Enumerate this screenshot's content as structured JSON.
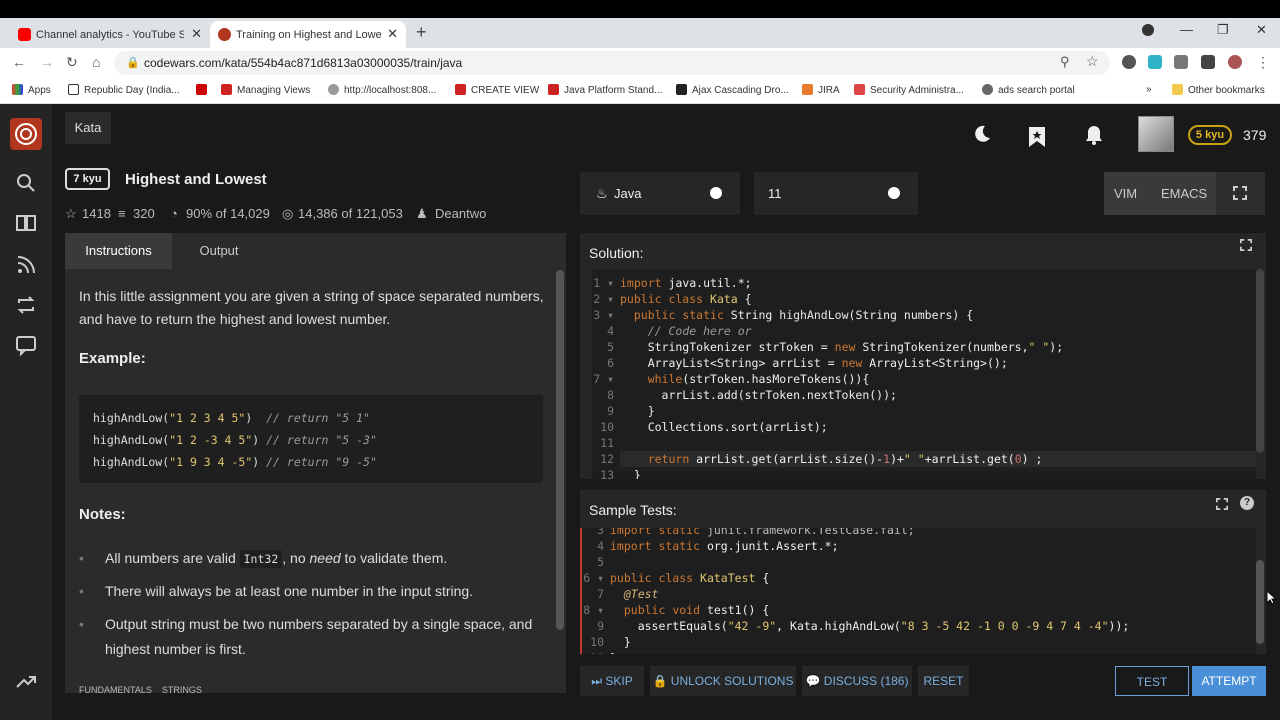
{
  "browser": {
    "tabs": [
      {
        "label": "Channel analytics - YouTube Stu",
        "active": false
      },
      {
        "label": "Training on Highest and Lowest",
        "active": true
      }
    ],
    "url": "codewars.com/kata/554b4ac871d6813a03000035/train/java",
    "bookmarks": [
      "Apps",
      "Republic Day (India...",
      "Managing Views",
      "http://localhost:808...",
      "CREATE VIEW",
      "Java Platform Stand...",
      "Ajax Cascading Dro...",
      "JIRA",
      "Security Administra...",
      "ads search portal",
      "Other bookmarks"
    ]
  },
  "header": {
    "kata_tab": "Kata",
    "user_rank": "5 kyu",
    "honor": "379"
  },
  "kata": {
    "rank": "7 kyu",
    "title": "Highest and Lowest",
    "stars": "1418",
    "collections": "320",
    "satisfaction": "90% of 14,029",
    "completions": "14,386 of 121,053",
    "author": "Deantwo"
  },
  "instructions": {
    "tabs": [
      "Instructions",
      "Output"
    ],
    "intro": "In this little assignment you are given a string of space separated numbers, and have to return the highest and lowest number.",
    "example_heading": "Example:",
    "examples": [
      {
        "call": "highAndLow(",
        "arg": "\"1 2 3 4 5\"",
        "close": ")  ",
        "comment": "// return \"5 1\""
      },
      {
        "call": "highAndLow(",
        "arg": "\"1 2 -3 4 5\"",
        "close": ") ",
        "comment": "// return \"5 -3\""
      },
      {
        "call": "highAndLow(",
        "arg": "\"1 9 3 4 -5\"",
        "close": ") ",
        "comment": "// return \"9 -5\""
      }
    ],
    "notes_heading": "Notes:",
    "notes": {
      "n1_pre": "All numbers are valid ",
      "n1_code": "Int32",
      "n1_mid": ", no ",
      "n1_em": "need",
      "n1_post": " to validate them.",
      "n2": "There will always be at least one number in the input string.",
      "n3": "Output string must be two numbers separated by a single space, and highest number is first."
    },
    "tags": [
      "FUNDAMENTALS",
      "STRINGS"
    ]
  },
  "editor": {
    "language": "Java",
    "version": "11",
    "modes": [
      "VIM",
      "EMACS"
    ],
    "solution_label": "Solution:",
    "tests_label": "Sample Tests:"
  },
  "actions": {
    "skip": "SKIP",
    "unlock": "UNLOCK SOLUTIONS",
    "discuss": "DISCUSS (186)",
    "reset": "RESET",
    "test": "TEST",
    "attempt": "ATTEMPT"
  },
  "colors": {
    "brand": "#b1361e",
    "accent": "#4a90d9",
    "rank_badge": "#c9a211"
  }
}
